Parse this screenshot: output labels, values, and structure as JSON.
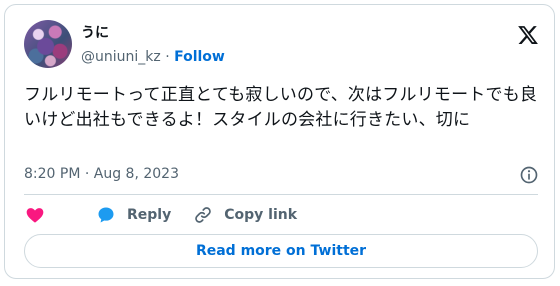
{
  "user": {
    "display_name": "うに",
    "handle": "@uniuni_kz",
    "separator": "·",
    "follow_label": "Follow"
  },
  "tweet": {
    "text": "フルリモートって正直とても寂しいので、次はフルリモートでも良いけど出社もできるよ！スタイルの会社に行きたい、切に",
    "timestamp": "8:20 PM · Aug 8, 2023"
  },
  "actions": {
    "like_icon": "heart-icon",
    "reply_label": "Reply",
    "copy_link_label": "Copy link"
  },
  "read_more_label": "Read more on Twitter",
  "colors": {
    "like": "#f91880",
    "reply": "#1d9bf0",
    "link": "#006fd6",
    "muted": "#536471",
    "border": "#cfd9de"
  }
}
